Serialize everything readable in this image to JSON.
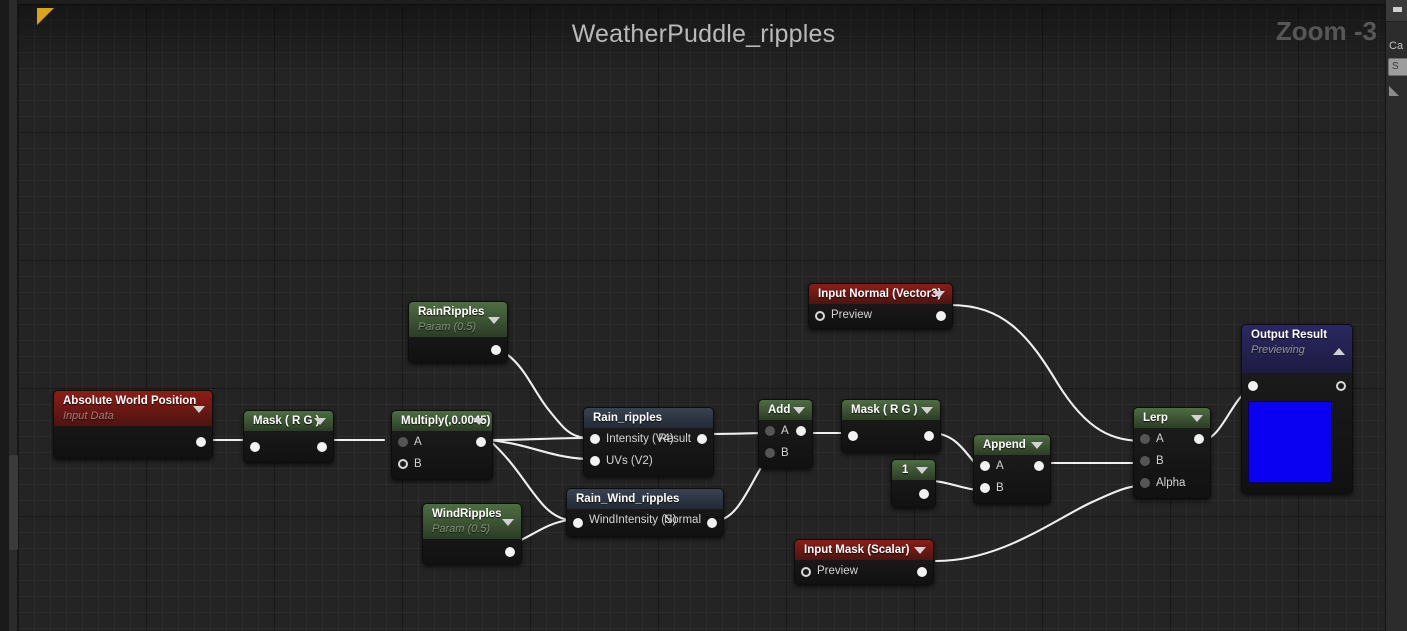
{
  "window": {
    "graph_title": "WeatherPuddle_ripples",
    "zoom_label": "Zoom -3"
  },
  "right_panel": {
    "title": "Ca",
    "search_value": "S"
  },
  "nodes": [
    {
      "id": "absolute-world-position",
      "title": "Absolute World Position",
      "subtitle": "Input Data",
      "header_color": "red",
      "inputs": [],
      "outputs": [
        ""
      ]
    },
    {
      "id": "mask-rg-1",
      "title": "Mask ( R G )",
      "header_color": "green",
      "inputs": [
        ""
      ],
      "outputs": [
        ""
      ]
    },
    {
      "id": "multiply",
      "title": "Multiply(,0.0045)",
      "header_color": "green",
      "inputs": [
        "A",
        "B"
      ],
      "outputs": [
        ""
      ]
    },
    {
      "id": "rain-ripples-param",
      "title": "RainRipples",
      "subtitle": "Param (0.5)",
      "header_color": "green",
      "inputs": [],
      "outputs": [
        ""
      ]
    },
    {
      "id": "wind-ripples-param",
      "title": "WindRipples",
      "subtitle": "Param (0.5)",
      "header_color": "green",
      "inputs": [],
      "outputs": [
        ""
      ]
    },
    {
      "id": "rain-ripples-func",
      "title": "Rain_ripples",
      "header_color": "plain",
      "inputs": [
        "Intensity (V4)",
        "UVs (V2)"
      ],
      "outputs": [
        "Result"
      ]
    },
    {
      "id": "rain-wind-ripples-func",
      "title": "Rain_Wind_ripples",
      "header_color": "plain",
      "inputs": [
        "WindIntensity (S)"
      ],
      "outputs": [
        "Normal"
      ]
    },
    {
      "id": "add",
      "title": "Add",
      "header_color": "green",
      "inputs": [
        "A",
        "B"
      ],
      "outputs": [
        ""
      ]
    },
    {
      "id": "mask-rg-2",
      "title": "Mask ( R G )",
      "header_color": "green",
      "inputs": [
        ""
      ],
      "outputs": [
        ""
      ]
    },
    {
      "id": "input-normal",
      "title": "Input Normal (Vector3)",
      "header_color": "red",
      "inputs": [
        "Preview"
      ],
      "outputs": [
        ""
      ]
    },
    {
      "id": "input-mask",
      "title": "Input Mask (Scalar)",
      "header_color": "red",
      "inputs": [
        "Preview"
      ],
      "outputs": [
        ""
      ]
    },
    {
      "id": "constant-one",
      "title": "1",
      "header_color": "green",
      "inputs": [],
      "outputs": [
        ""
      ]
    },
    {
      "id": "append",
      "title": "Append",
      "header_color": "green",
      "inputs": [
        "A",
        "B"
      ],
      "outputs": [
        ""
      ]
    },
    {
      "id": "lerp",
      "title": "Lerp",
      "header_color": "green",
      "inputs": [
        "A",
        "B",
        "Alpha"
      ],
      "outputs": [
        ""
      ]
    },
    {
      "id": "output-result",
      "title": "Output Result",
      "subtitle": "Previewing",
      "header_color": "purple",
      "inputs": [
        ""
      ],
      "outputs": [
        ""
      ],
      "preview_color": "#0a00f2"
    }
  ],
  "labels": {
    "absolute_world_position_title": "Absolute World Position",
    "absolute_world_position_sub": "Input Data",
    "mask1_title": "Mask ( R G )",
    "multiply_title": "Multiply(,0.0045)",
    "multiply_a": "A",
    "multiply_b": "B",
    "rain_param_title": "RainRipples",
    "rain_param_sub": "Param (0.5)",
    "wind_param_title": "WindRipples",
    "wind_param_sub": "Param (0.5)",
    "rain_func_title": "Rain_ripples",
    "rain_func_in1": "Intensity (V4)",
    "rain_func_in2": "UVs (V2)",
    "rain_func_out": "Result",
    "rainwind_func_title": "Rain_Wind_ripples",
    "rainwind_func_in1": "WindIntensity (S)",
    "rainwind_func_out": "Normal",
    "add_title": "Add",
    "add_a": "A",
    "add_b": "B",
    "mask2_title": "Mask ( R G )",
    "input_normal_title": "Input Normal (Vector3)",
    "input_normal_preview": "Preview",
    "input_mask_title": "Input Mask (Scalar)",
    "input_mask_preview": "Preview",
    "const_one_title": "1",
    "append_title": "Append",
    "append_a": "A",
    "append_b": "B",
    "lerp_title": "Lerp",
    "lerp_a": "A",
    "lerp_b": "B",
    "lerp_alpha": "Alpha",
    "output_title": "Output Result",
    "output_sub": "Previewing"
  },
  "colors": {
    "canvas": "#242424",
    "header_green": "#4e6d43",
    "header_red": "#8b1d17",
    "header_purple": "#2b2860",
    "wire": "#ffffff",
    "preview_blue": "#0a00f2",
    "corner_flag": "#d9a41a"
  }
}
